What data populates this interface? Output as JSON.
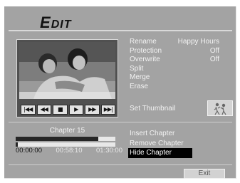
{
  "title": {
    "first": "E",
    "rest": "DIT"
  },
  "menu": {
    "items": [
      {
        "label": "Rename",
        "value": "Happy Hours"
      },
      {
        "label": "Protection",
        "value": "Off"
      },
      {
        "label": "Overwrite",
        "value": "Off"
      },
      {
        "label": "Split",
        "value": ""
      },
      {
        "label": "Merge",
        "value": ""
      },
      {
        "label": "Erase",
        "value": ""
      }
    ],
    "thumbnail_label": "Set Thumbnail"
  },
  "controls": [
    {
      "name": "skip-back-button",
      "glyph": "|◀◀"
    },
    {
      "name": "rewind-button",
      "glyph": "◀◀"
    },
    {
      "name": "stop-button",
      "glyph": "■"
    },
    {
      "name": "play-button",
      "glyph": "▶"
    },
    {
      "name": "fast-forward-button",
      "glyph": "▶▶"
    },
    {
      "name": "skip-forward-button",
      "glyph": "▶▶|"
    }
  ],
  "chapter": {
    "title": "Chapter 15",
    "progress_fraction_upper": 0.83,
    "progress_fraction_lower": 0.02,
    "time_current": "00:00:00",
    "time_chapter": "00:58:10",
    "time_total": "01:30:00"
  },
  "chapter_menu": [
    {
      "label": "Insert Chapter",
      "selected": false
    },
    {
      "label": "Remove Chapter",
      "selected": false
    },
    {
      "label": "Hide Chapter",
      "selected": true
    }
  ],
  "exit_label": "Exit"
}
